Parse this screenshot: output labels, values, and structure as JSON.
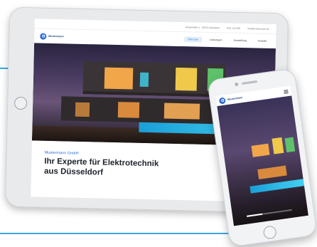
{
  "tablet": {
    "topbar_items": [
      "Hauptstraße 1 · 40210 Düsseldorf",
      "0211 123 456",
      "info@mustermann.de"
    ],
    "logo_text": "Mustermann",
    "nav": [
      "Über uns",
      "Leistungen",
      "Ausstellung",
      "Kontakt"
    ],
    "nav_active_index": 0,
    "hero_subtitle": "Mustermann GmbH",
    "hero_headline_line1": "Ihr Experte für Elektrotechnik",
    "hero_headline_line2": "aus Düsseldorf"
  },
  "phone": {
    "logo_text": "Mustermann"
  },
  "colors": {
    "accent_line": "#3ba7e6",
    "brand_blue": "#2e6fd0",
    "headline": "#1d232b"
  }
}
